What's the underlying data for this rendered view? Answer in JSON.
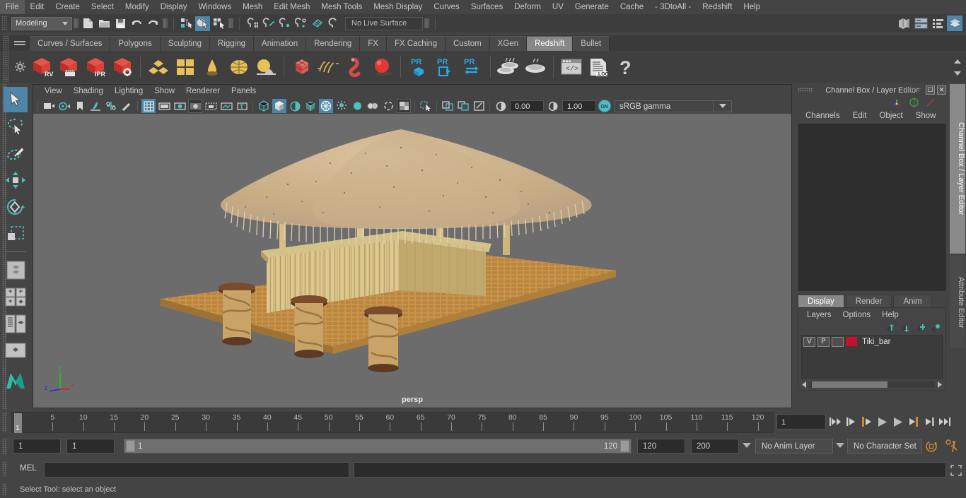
{
  "menubar": {
    "items": [
      "File",
      "Edit",
      "Create",
      "Select",
      "Modify",
      "Display",
      "Windows",
      "Mesh",
      "Edit Mesh",
      "Mesh Tools",
      "Mesh Display",
      "Curves",
      "Surfaces",
      "Deform",
      "UV",
      "Generate",
      "Cache",
      "- 3DtoAll -",
      "Redshift",
      "Help"
    ]
  },
  "statusline": {
    "mode": "Modeling",
    "live_surface": "No Live Surface",
    "icons": [
      "new-scene-icon",
      "open-scene-icon",
      "save-scene-icon",
      "undo-icon",
      "redo-icon",
      "select-hierarchy-icon",
      "select-object-icon",
      "select-component-icon",
      "snap-grid-icon",
      "snap-curve-icon",
      "snap-point-icon",
      "snap-projected-center-icon",
      "snap-view-plane-icon",
      "make-live-icon"
    ],
    "right_icons": [
      "show-hide-editor-icon",
      "attribute-editor-icon",
      "tool-settings-icon",
      "channel-box-icon"
    ]
  },
  "shelf": {
    "tabs": [
      "Curves / Surfaces",
      "Polygons",
      "Sculpting",
      "Rigging",
      "Animation",
      "Rendering",
      "FX",
      "FX Caching",
      "Custom",
      "XGen",
      "Redshift",
      "Bullet"
    ],
    "active_tab": "Redshift",
    "buttons": [
      "redshift-render-view-icon",
      "redshift-sequence-render-icon",
      "redshift-ipr-icon",
      "redshift-render-settings-icon",
      "rs-proxy-icon",
      "rs-matte-icon",
      "rs-bokeh-icon",
      "rs-dome-light-icon",
      "rs-environment-icon",
      "rs-volume-icon",
      "rs-hair-icon",
      "rs-curve-icon",
      "rs-sphere-light-icon",
      "pr-object-icon",
      "pr-export-icon",
      "pr-transfer-icon",
      "rs-bake-set-icon",
      "rs-bake-icon",
      "rs-script-editor-icon",
      "rs-log-icon",
      "rs-help-icon"
    ]
  },
  "toolbox": {
    "items": [
      "select-tool",
      "lasso-select-tool",
      "paint-select-tool",
      "move-tool",
      "rotate-tool",
      "scale-tool",
      "last-tool-used",
      "quick-layout-single",
      "quick-layout-four",
      "quick-layout-persp-outliner",
      "quick-layout-persp-graph",
      "quick-layout-hypershade",
      "maya-logo"
    ],
    "selected": "select-tool"
  },
  "viewport": {
    "menus": [
      "View",
      "Shading",
      "Lighting",
      "Show",
      "Renderer",
      "Panels"
    ],
    "toolbar_icons": [
      "select-camera-icon",
      "camera-attributes-icon",
      "bookmark-icon",
      "image-plane-icon",
      "two-d-pan-zoom-icon",
      "grease-pencil-icon",
      "grid-icon",
      "film-gate-icon",
      "resolution-gate-icon",
      "gate-mask-icon",
      "film-origin-icon",
      "xray-icon",
      "xray-joints-icon",
      "wireframe-icon",
      "smooth-shade-icon",
      "shade-wire-icon",
      "textured-icon",
      "lighting-icon",
      "shadows-icon",
      "screen-space-ao-icon",
      "motion-blur-icon",
      "multisample-icon",
      "depth-of-field-icon",
      "isolate-select-icon",
      "xray-toggle-icon",
      "gpu-cache-icon",
      "display-layer-icon",
      "viewcube-icon"
    ],
    "exposure": "0.00",
    "gamma": "1.00",
    "color_management_toggle": "ON",
    "color_space": "sRGB gamma",
    "camera_label": "persp",
    "axis_labels": {
      "x": "x",
      "y": "y",
      "z": "z"
    },
    "scene_description": "tiki-bar-3d-model"
  },
  "right_panel": {
    "title": "Channel Box / Layer Editor",
    "window_buttons": [
      "restore-button",
      "close-button"
    ],
    "header_icons": [
      "axis-gizmo-icon",
      "rotate-gizmo-icon",
      "scale-gizmo-icon"
    ],
    "menu": [
      "Channels",
      "Edit",
      "Object",
      "Show"
    ],
    "layer_tabs": [
      "Display",
      "Render",
      "Anim"
    ],
    "active_layer_tab": "Display",
    "layer_menu": [
      "Layers",
      "Options",
      "Help"
    ],
    "layer_buttons": [
      "move-layer-up-icon",
      "move-layer-down-icon",
      "new-layer-icon",
      "new-layer-from-selected-icon"
    ],
    "layers": [
      {
        "visibility": "V",
        "playback": "P",
        "type": "",
        "color": "#c8102e",
        "name": "Tiki_bar"
      }
    ],
    "vertical_tabs": [
      "Channel Box / Layer Editor",
      "Attribute Editor"
    ],
    "active_vertical_tab": "Channel Box / Layer Editor"
  },
  "timeslider": {
    "ticks": [
      5,
      10,
      15,
      20,
      25,
      30,
      35,
      40,
      45,
      50,
      55,
      60,
      65,
      70,
      75,
      80,
      85,
      90,
      95,
      100,
      105,
      110,
      115,
      120
    ],
    "current_frame": "1",
    "current_frame_field": "1",
    "playback_buttons": [
      "go-to-start-icon",
      "step-back-keyframe-icon",
      "step-back-frame-icon",
      "play-backwards-icon",
      "play-forwards-icon",
      "step-forward-frame-icon",
      "step-forward-keyframe-icon",
      "go-to-end-icon"
    ]
  },
  "rangeslider": {
    "anim_start": "1",
    "range_start": "1",
    "bar_start_label": "1",
    "bar_end_label": "120",
    "range_end": "120",
    "anim_end": "200",
    "anim_layer": "No Anim Layer",
    "character_set": "No Character Set",
    "right_icons": [
      "auto-keyframe-icon",
      "animation-preferences-icon"
    ]
  },
  "commandline": {
    "label": "MEL",
    "input_value": "",
    "output_value": "",
    "expand_icon": "expand-script-editor-icon"
  },
  "helpline": {
    "text": "Select Tool: select an object"
  },
  "colors": {
    "accent_blue": "#4e86a8",
    "shelf_highlight": "#878787",
    "layer_color": "#c8102e",
    "viewport_bg": "#6c6c6c",
    "orange": "#d08833"
  }
}
